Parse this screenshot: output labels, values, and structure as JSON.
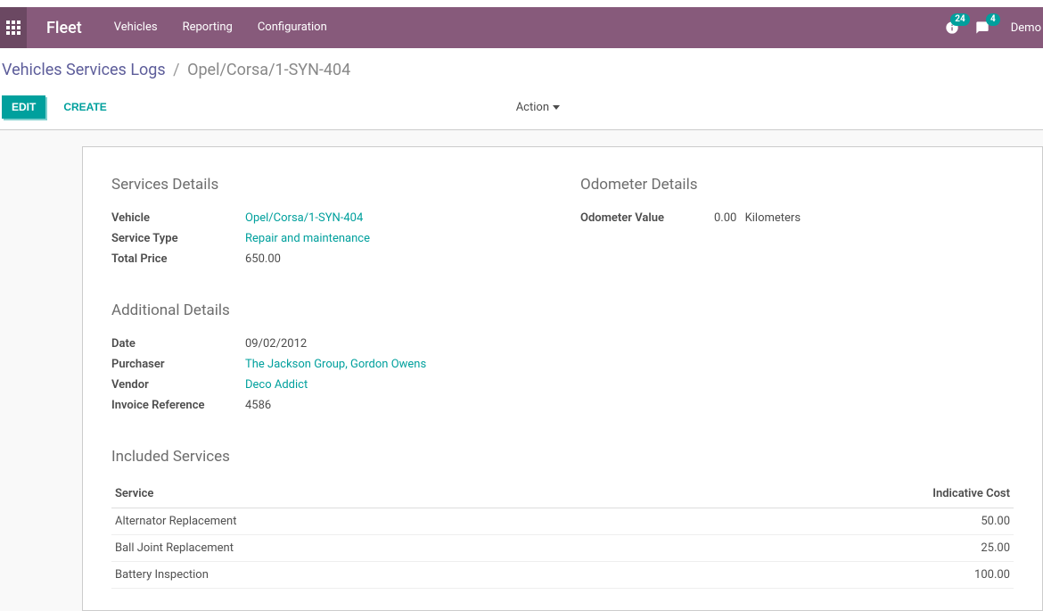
{
  "navbar": {
    "brand": "Fleet",
    "menu": [
      "Vehicles",
      "Reporting",
      "Configuration"
    ],
    "badge_activities": "24",
    "badge_messages": "4",
    "user": "Demo"
  },
  "breadcrumb": {
    "parent": "Vehicles Services Logs",
    "current": "Opel/Corsa/1-SYN-404"
  },
  "controls": {
    "edit": "EDIT",
    "create": "CREATE",
    "action": "Action"
  },
  "services_details": {
    "title": "Services Details",
    "vehicle_label": "Vehicle",
    "vehicle_value": "Opel/Corsa/1-SYN-404",
    "service_type_label": "Service Type",
    "service_type_value": "Repair and maintenance",
    "total_price_label": "Total Price",
    "total_price_value": "650.00"
  },
  "odometer_details": {
    "title": "Odometer Details",
    "value_label": "Odometer Value",
    "value_amount": "0.00",
    "value_unit": "Kilometers"
  },
  "additional_details": {
    "title": "Additional Details",
    "date_label": "Date",
    "date_value": "09/02/2012",
    "purchaser_label": "Purchaser",
    "purchaser_value": "The Jackson Group, Gordon Owens",
    "vendor_label": "Vendor",
    "vendor_value": "Deco Addict",
    "invoice_ref_label": "Invoice Reference",
    "invoice_ref_value": "4586"
  },
  "included_services": {
    "title": "Included Services",
    "columns": {
      "service": "Service",
      "cost": "Indicative Cost"
    },
    "rows": [
      {
        "service": "Alternator Replacement",
        "cost": "50.00"
      },
      {
        "service": "Ball Joint Replacement",
        "cost": "25.00"
      },
      {
        "service": "Battery Inspection",
        "cost": "100.00"
      }
    ]
  }
}
